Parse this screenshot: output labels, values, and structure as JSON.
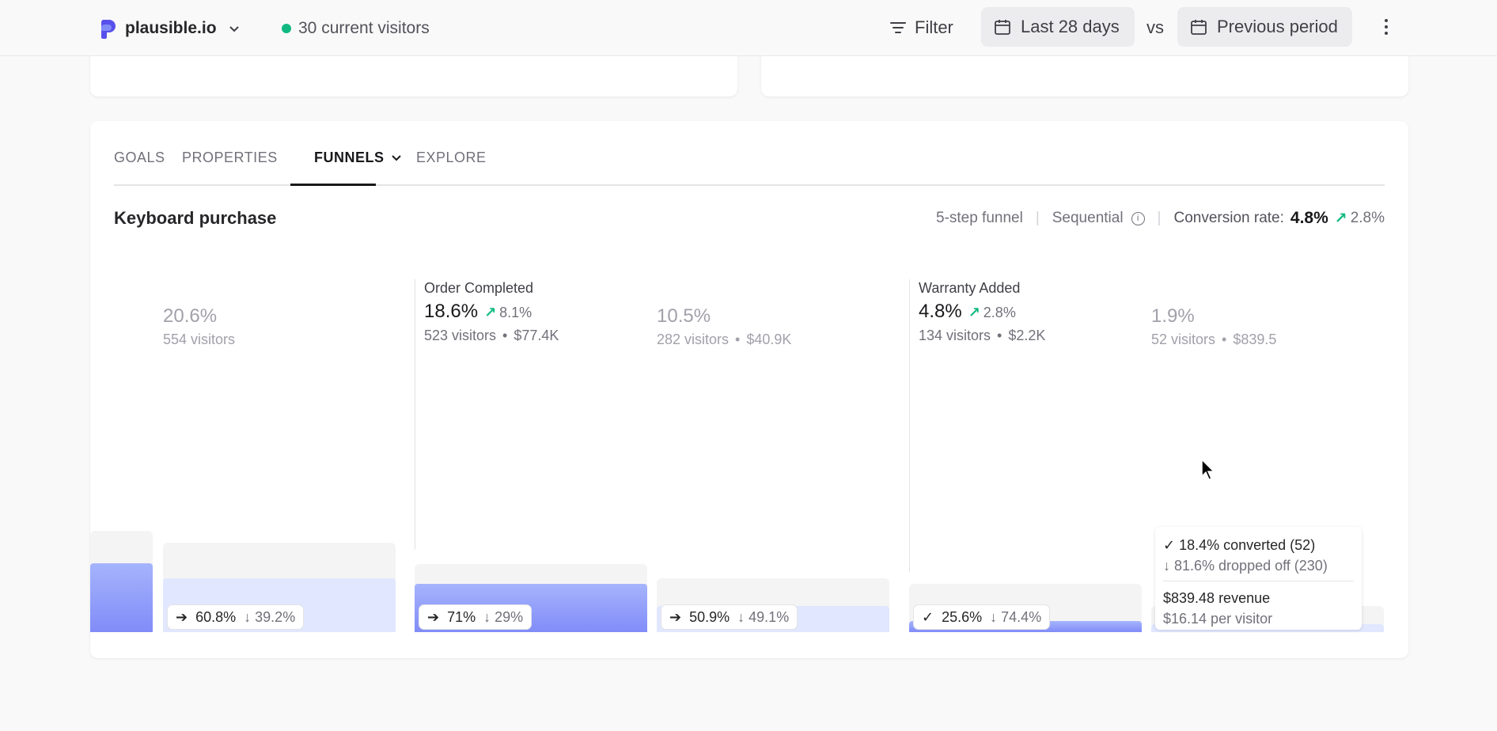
{
  "topbar": {
    "site_name": "plausible.io",
    "current_visitors": "30 current visitors",
    "filter_label": "Filter",
    "date_range": "Last 28 days",
    "vs_label": "vs",
    "compare_label": "Previous period"
  },
  "tabs": [
    {
      "label": "GOALS"
    },
    {
      "label": "PROPERTIES"
    },
    {
      "label": "FUNNELS",
      "active": true
    },
    {
      "label": "EXPLORE"
    }
  ],
  "funnel": {
    "title": "Keyboard purchase",
    "steps_label": "5-step funnel",
    "mode_label": "Sequential",
    "conversion_label": "Conversion rate:",
    "conversion_rate": "4.8%",
    "conversion_change": "2.8%"
  },
  "steps": [
    {
      "pct": "20.6%",
      "visitors": "554 visitors"
    },
    {
      "name": "Order Completed",
      "pct": "18.6%",
      "change": "8.1%",
      "visitors": "523 visitors",
      "revenue": "$77.4K"
    },
    {
      "pct": "10.5%",
      "visitors": "282 visitors",
      "revenue": "$40.9K"
    },
    {
      "name": "Warranty Added",
      "pct": "4.8%",
      "change": "2.8%",
      "visitors": "134 visitors",
      "revenue": "$2.2K"
    },
    {
      "pct": "1.9%",
      "visitors": "52 visitors",
      "revenue": "$839.5"
    }
  ],
  "pills": [
    {
      "icon": "arrow-right-icon",
      "continue": "60.8%",
      "drop": "39.2%"
    },
    {
      "icon": "arrow-right-icon",
      "continue": "71%",
      "drop": "29%"
    },
    {
      "icon": "arrow-right-icon",
      "continue": "50.9%",
      "drop": "49.1%"
    },
    {
      "icon": "check-icon",
      "continue": "25.6%",
      "drop": "74.4%"
    }
  ],
  "tooltip": {
    "converted": "✓ 18.4% converted (52)",
    "dropped": "↓ 81.6% dropped off (230)",
    "revenue": "$839.48 revenue",
    "per_visitor": "$16.14 per visitor"
  },
  "colors": {
    "accent": "#818cf8",
    "accent_light": "#e0e7ff",
    "positive": "#10b981",
    "live_dot": "#10b981"
  }
}
